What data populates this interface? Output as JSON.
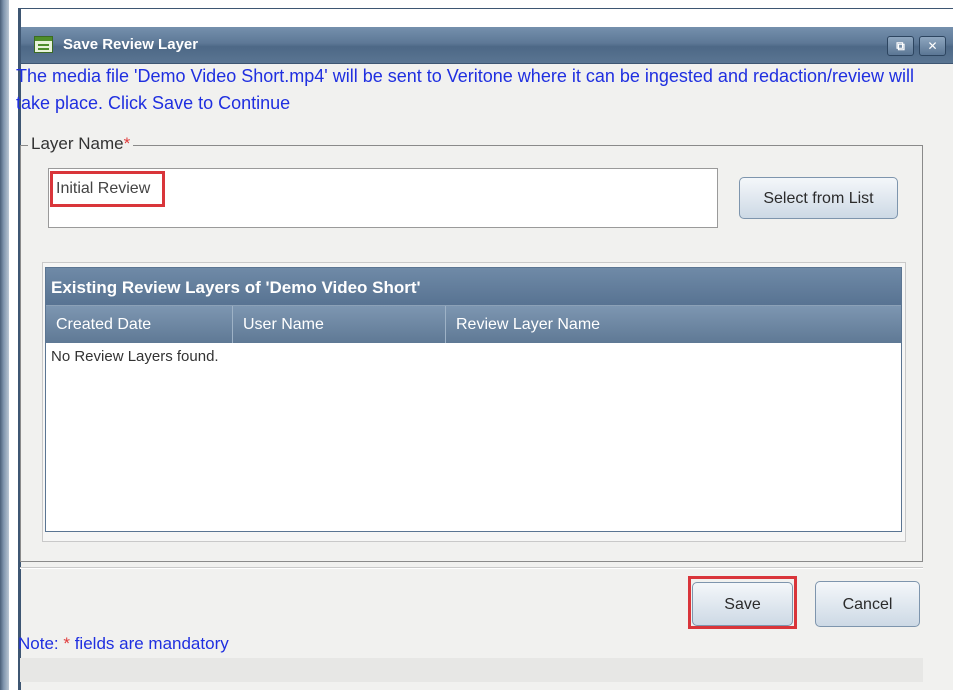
{
  "window": {
    "title": "Save Review Layer",
    "restore_glyph": "⧉",
    "close_glyph": "✕"
  },
  "intro_text": "The media file 'Demo Video Short.mp4' will be sent to Veritone where it can be ingested and redaction/review will take place. Click Save to Continue",
  "layer_name": {
    "label": "Layer Name",
    "required_marker": "*",
    "value": "Initial Review",
    "select_button": "Select from List"
  },
  "grid": {
    "title": "Existing Review Layers of 'Demo Video Short'",
    "columns": [
      "Created Date",
      "User Name",
      "Review Layer Name"
    ],
    "empty_message": "No Review Layers found."
  },
  "buttons": {
    "save": "Save",
    "cancel": "Cancel"
  },
  "note": {
    "prefix": "Note: ",
    "marker": "*",
    "suffix": " fields are mandatory"
  },
  "colors": {
    "title_bar": "#5d7896",
    "info_text": "#1f2fe0",
    "required": "#e03a3a",
    "highlight_outline": "#d9353a"
  }
}
